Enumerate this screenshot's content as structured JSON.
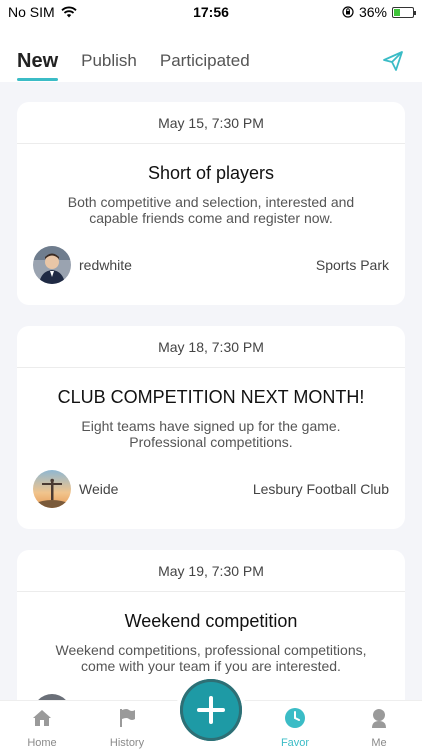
{
  "status_bar": {
    "carrier": "No SIM",
    "time": "17:56",
    "battery_percent": "36%",
    "battery_level": 0.36,
    "icons": [
      "wifi-icon",
      "orientation-lock-icon",
      "battery-charging-icon"
    ]
  },
  "header": {
    "tabs": [
      {
        "label": "New",
        "active": true
      },
      {
        "label": "Publish",
        "active": false
      },
      {
        "label": "Participated",
        "active": false
      }
    ],
    "action_icon": "send-icon",
    "accent_color": "#3bbcc6"
  },
  "cards": [
    {
      "date": "May 15, 7:30 PM",
      "title": "Short of players",
      "description": "Both competitive and selection, interested and capable friends come and register now.",
      "user": "redwhite",
      "location": "Sports Park"
    },
    {
      "date": "May 18, 7:30 PM",
      "title": "CLUB COMPETITION NEXT MONTH!",
      "description": "Eight teams have signed up for the game. Professional competitions.",
      "user": "Weide",
      "location": "Lesbury Football Club"
    },
    {
      "date": "May 19, 7:30 PM",
      "title": "Weekend competition",
      "description": "Weekend competitions, professional competitions, come with your team if you are interested.",
      "user": "",
      "location": ""
    }
  ],
  "bottom_nav": {
    "items": [
      {
        "label": "Home",
        "icon": "home-icon"
      },
      {
        "label": "History",
        "icon": "flag-icon"
      },
      {
        "label": "Favor",
        "icon": "clock-icon",
        "active": true
      },
      {
        "label": "Me",
        "icon": "person-icon"
      }
    ],
    "fab_icon": "plus-icon",
    "fab_color": "#1e9aa5"
  }
}
